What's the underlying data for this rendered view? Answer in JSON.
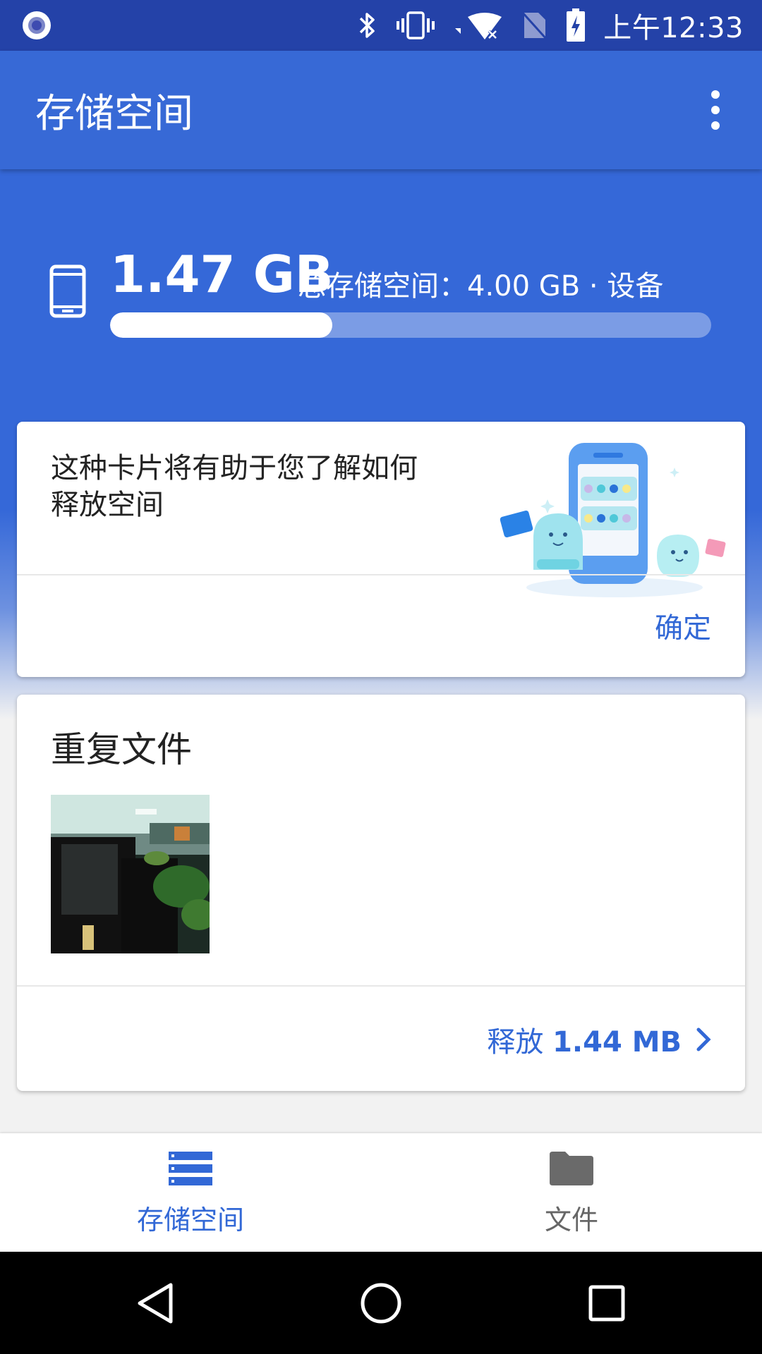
{
  "status_bar": {
    "time": "上午12:33",
    "icons": [
      "assistant-icon",
      "bluetooth-icon",
      "vibrate-icon",
      "wifi-off-icon",
      "no-sim-icon",
      "battery-charging-icon"
    ]
  },
  "app_bar": {
    "title": "存储空间",
    "overflow_icon": "more-vert-icon"
  },
  "storage": {
    "used": "1.47 GB",
    "total_label": "总存储空间：4.00 GB · 设备",
    "used_fraction": 0.37
  },
  "tip_card": {
    "text": "这种卡片将有助于您了解如何释放空间",
    "ok_label": "确定"
  },
  "duplicates_card": {
    "title": "重复文件",
    "free_label": "释放",
    "free_value": "1.44 MB"
  },
  "bottom_nav": {
    "items": [
      {
        "label": "存储空间",
        "icon": "storage-icon",
        "active": true
      },
      {
        "label": "文件",
        "icon": "folder-icon",
        "active": false
      }
    ]
  },
  "colors": {
    "primary": "#3769d6",
    "status_bar": "#2442a8",
    "accent_text": "#3268d6"
  }
}
